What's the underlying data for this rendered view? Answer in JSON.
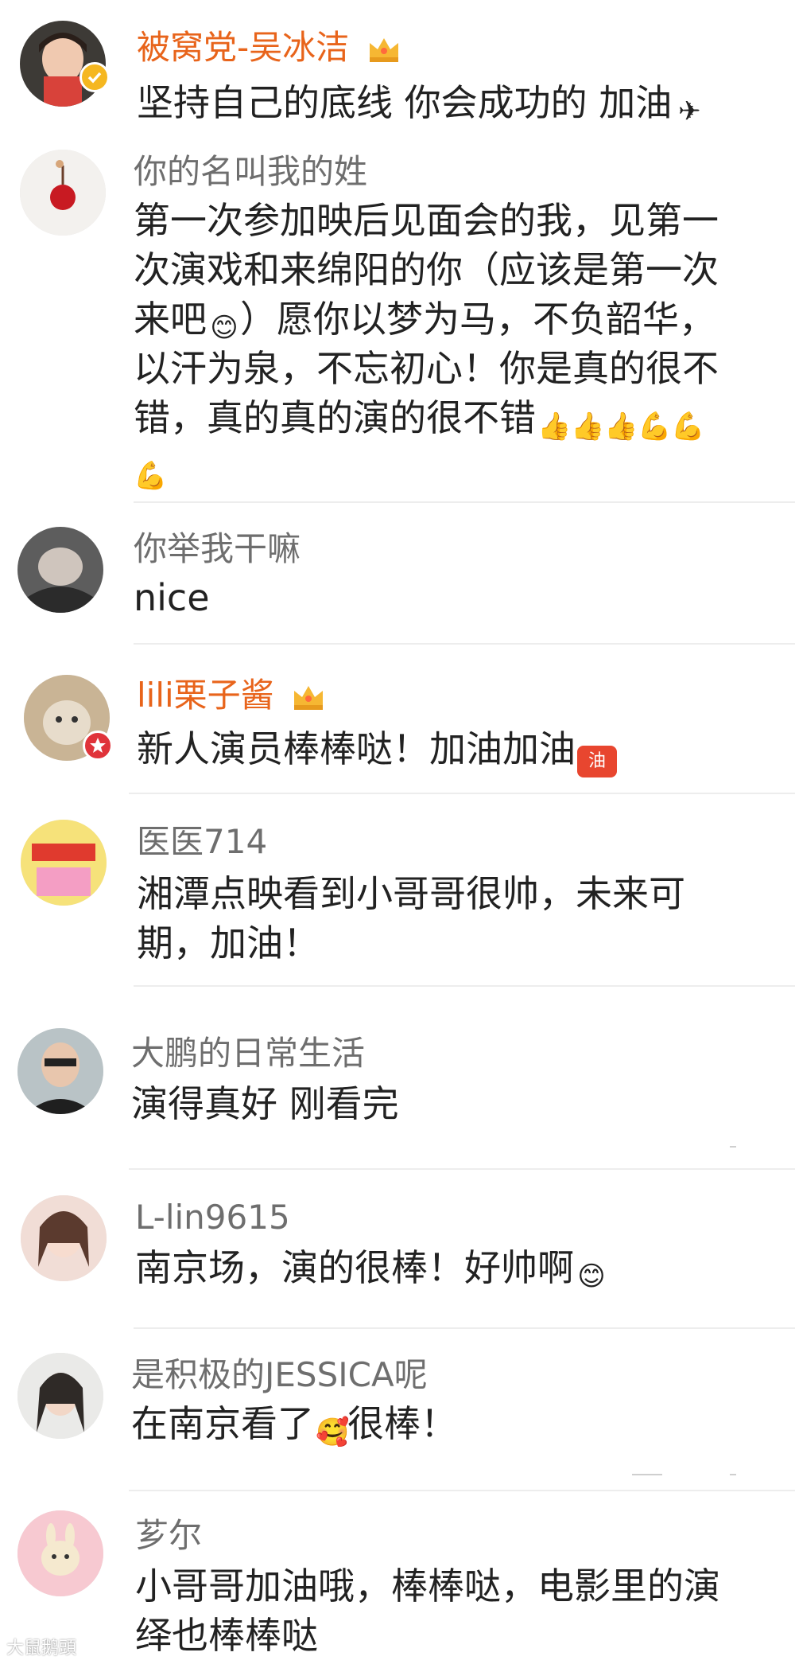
{
  "colors": {
    "vip_name": "#e8641b",
    "name": "#6e6e6e",
    "text": "#222222",
    "divider": "#ededed"
  },
  "comments": [
    {
      "username": "被窝党-吴冰洁",
      "text": "坚持自己的底线 你会成功的 加油",
      "emoji_end": "airplane-emoji",
      "vip": true
    },
    {
      "username": "你的名叫我的姓",
      "lines": [
        "第一次参加映后见面会的我，见第一",
        "次演戏和来绵阳的你（应该是第一次",
        "来吧",
        "）愿你以梦为马，不负韶华，",
        "以汗为泉，不忘初心！你是真的很不",
        "错，真的真的演的很不错"
      ]
    },
    {
      "username": "你举我干嘛",
      "text": "nice"
    },
    {
      "username": "lili栗子酱",
      "text": "新人演员棒棒哒！加油加油",
      "emoji_end": "jiayou-emoji",
      "vip": true
    },
    {
      "username": "医医714",
      "lines": [
        "湘潭点映看到小哥哥很帅，未来可",
        "期，加油！"
      ]
    },
    {
      "username": "大鹏的日常生活",
      "text": "演得真好 刚看完"
    },
    {
      "username": "L-lin9615",
      "text": "南京场，演的很棒！好帅啊",
      "emoji_end": "shy-emoji"
    },
    {
      "username": "是积极的JESSICA呢",
      "text_before": "在南京看了",
      "text_after": "很棒！",
      "emoji_mid": "love-emoji"
    },
    {
      "username": "芗尔",
      "lines": [
        "小哥哥加油哦，棒棒哒，电影里的演",
        "绎也棒棒哒"
      ]
    }
  ],
  "watermark": "大鼠鹅頭"
}
